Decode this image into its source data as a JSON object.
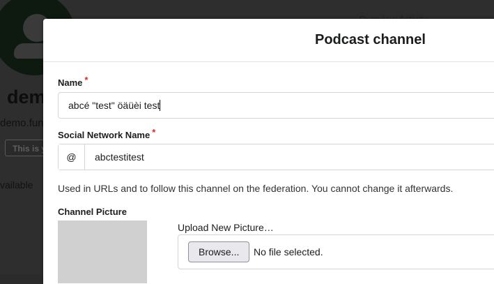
{
  "background": {
    "channel_name": "demo",
    "channel_handle": "demo.fun",
    "badge": "This is y",
    "availability": "vailable",
    "top_nav": "Overview    Activity"
  },
  "modal": {
    "title": "Podcast channel",
    "name_field": {
      "label": "Name",
      "required_mark": "*",
      "value": "abcé \"test\" öäüèi test"
    },
    "social_field": {
      "label": "Social Network Name",
      "required_mark": "*",
      "prefix": "@",
      "value": "abctestitest",
      "help": "Used in URLs and to follow this channel on the federation. You cannot change it afterwards."
    },
    "picture": {
      "label": "Channel Picture",
      "upload_label": "Upload New Picture…",
      "browse_label": "Browse...",
      "file_status": "No file selected."
    }
  }
}
